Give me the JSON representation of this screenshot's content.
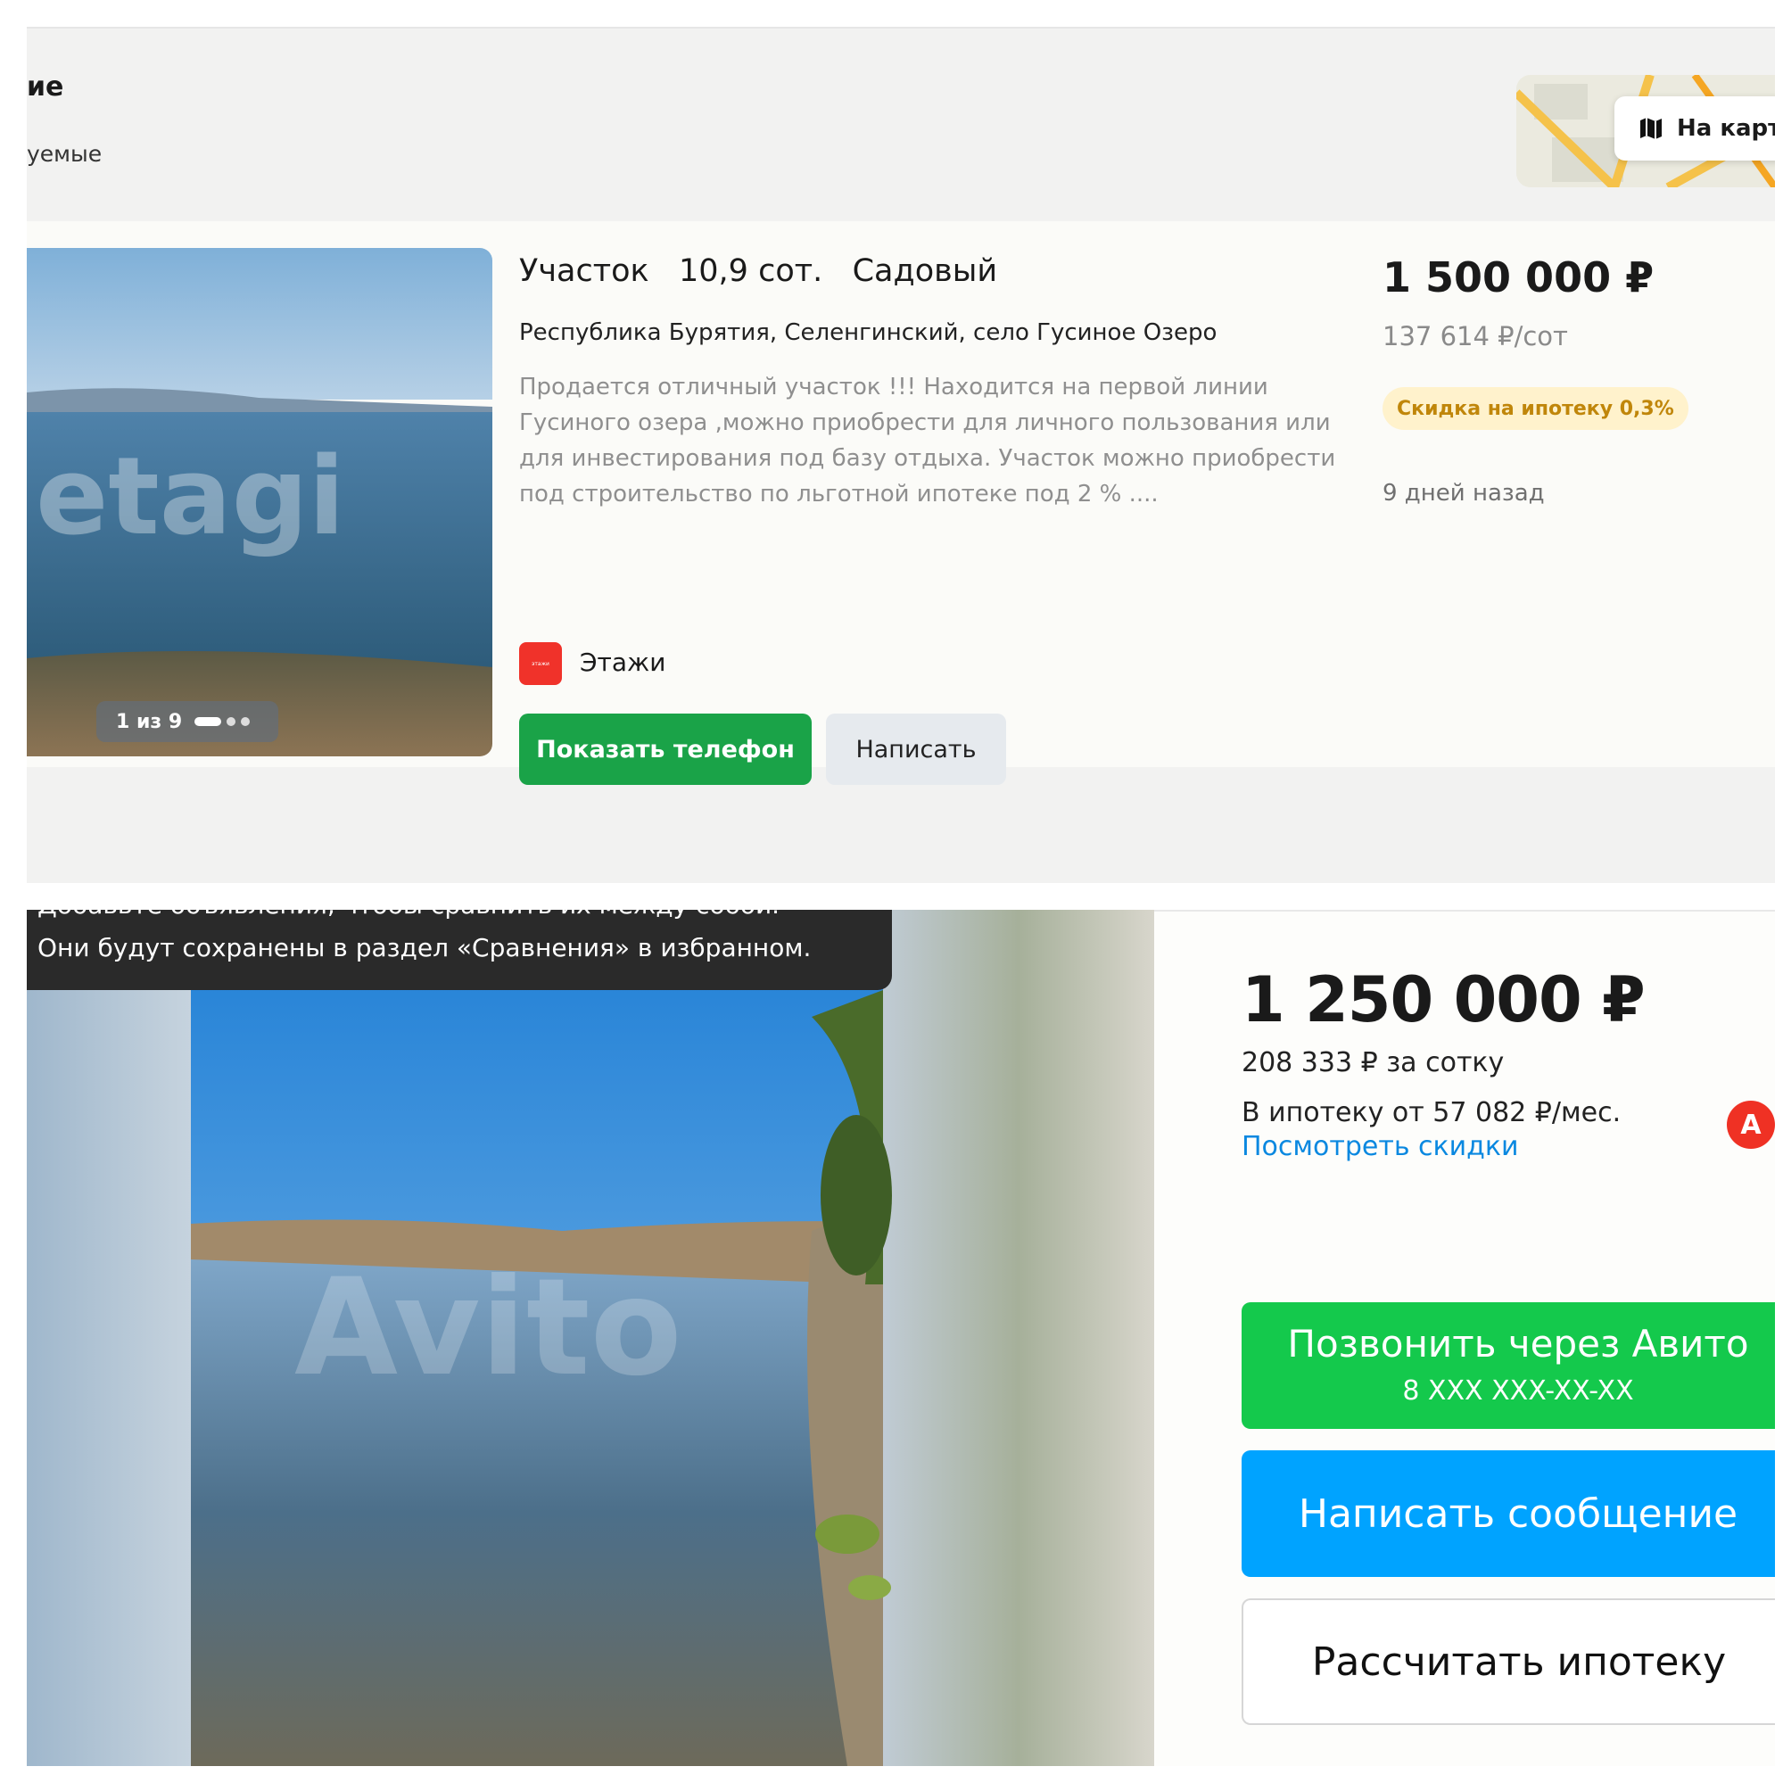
{
  "top": {
    "header": {
      "title": "ие",
      "subtitle": "уемые",
      "map_button": "На карт",
      "map_icon": "map-icon"
    },
    "listing": {
      "title": "Участок   10,9 сот.   Садовый",
      "address": "Республика Бурятия, Селенгинский, село Гусиное Озеро",
      "description": "Продается отличный участок !!! Находится на первой линии Гусиного озера ,можно приобрести для личного пользования или для инвестирования под базу отдыха. Участок можно приобрести под строительство по льготной ипотеке под 2 % ....",
      "photo_counter": "1 из 9",
      "photo_watermark": "etagi",
      "agency_name": "Этажи",
      "agency_logo_text": "этажи",
      "show_phone_button": "Показать телефон",
      "write_button": "Написать",
      "price": "1 500 000 ₽",
      "price_per_unit": "137 614 ₽/сот",
      "discount_badge": "Скидка на ипотеку 0,3%",
      "posted_ago": "9 дней назад"
    }
  },
  "bottom": {
    "tooltip": {
      "line1_cut": "Добавьте объявления, чтобы сравнить их между собой.",
      "line2": "Они будут сохранены в раздел «Сравнения» в избранном."
    },
    "photo_watermark": "Avito",
    "price": "1 250 000 ₽",
    "price_per_unit": "208 333 ₽ за сотку",
    "mortgage_text": "В ипотеку от 57 082 ₽/мес.",
    "discounts_link": "Посмотреть скидки",
    "bank_badge": "А",
    "call_button": {
      "label": "Позвонить через Авито",
      "phone": "8 XXX XXX-XX-XX"
    },
    "message_button": "Написать сообщение",
    "mortgage_button": "Рассчитать ипотеку"
  },
  "colors": {
    "etagi_green": "#1aa348",
    "avito_green": "#14c94c",
    "avito_blue": "#00a3ff",
    "link_blue": "#0a88e0",
    "discount_bg": "#fff2cc",
    "discount_text": "#c0860a",
    "agency_red": "#f0322a"
  }
}
